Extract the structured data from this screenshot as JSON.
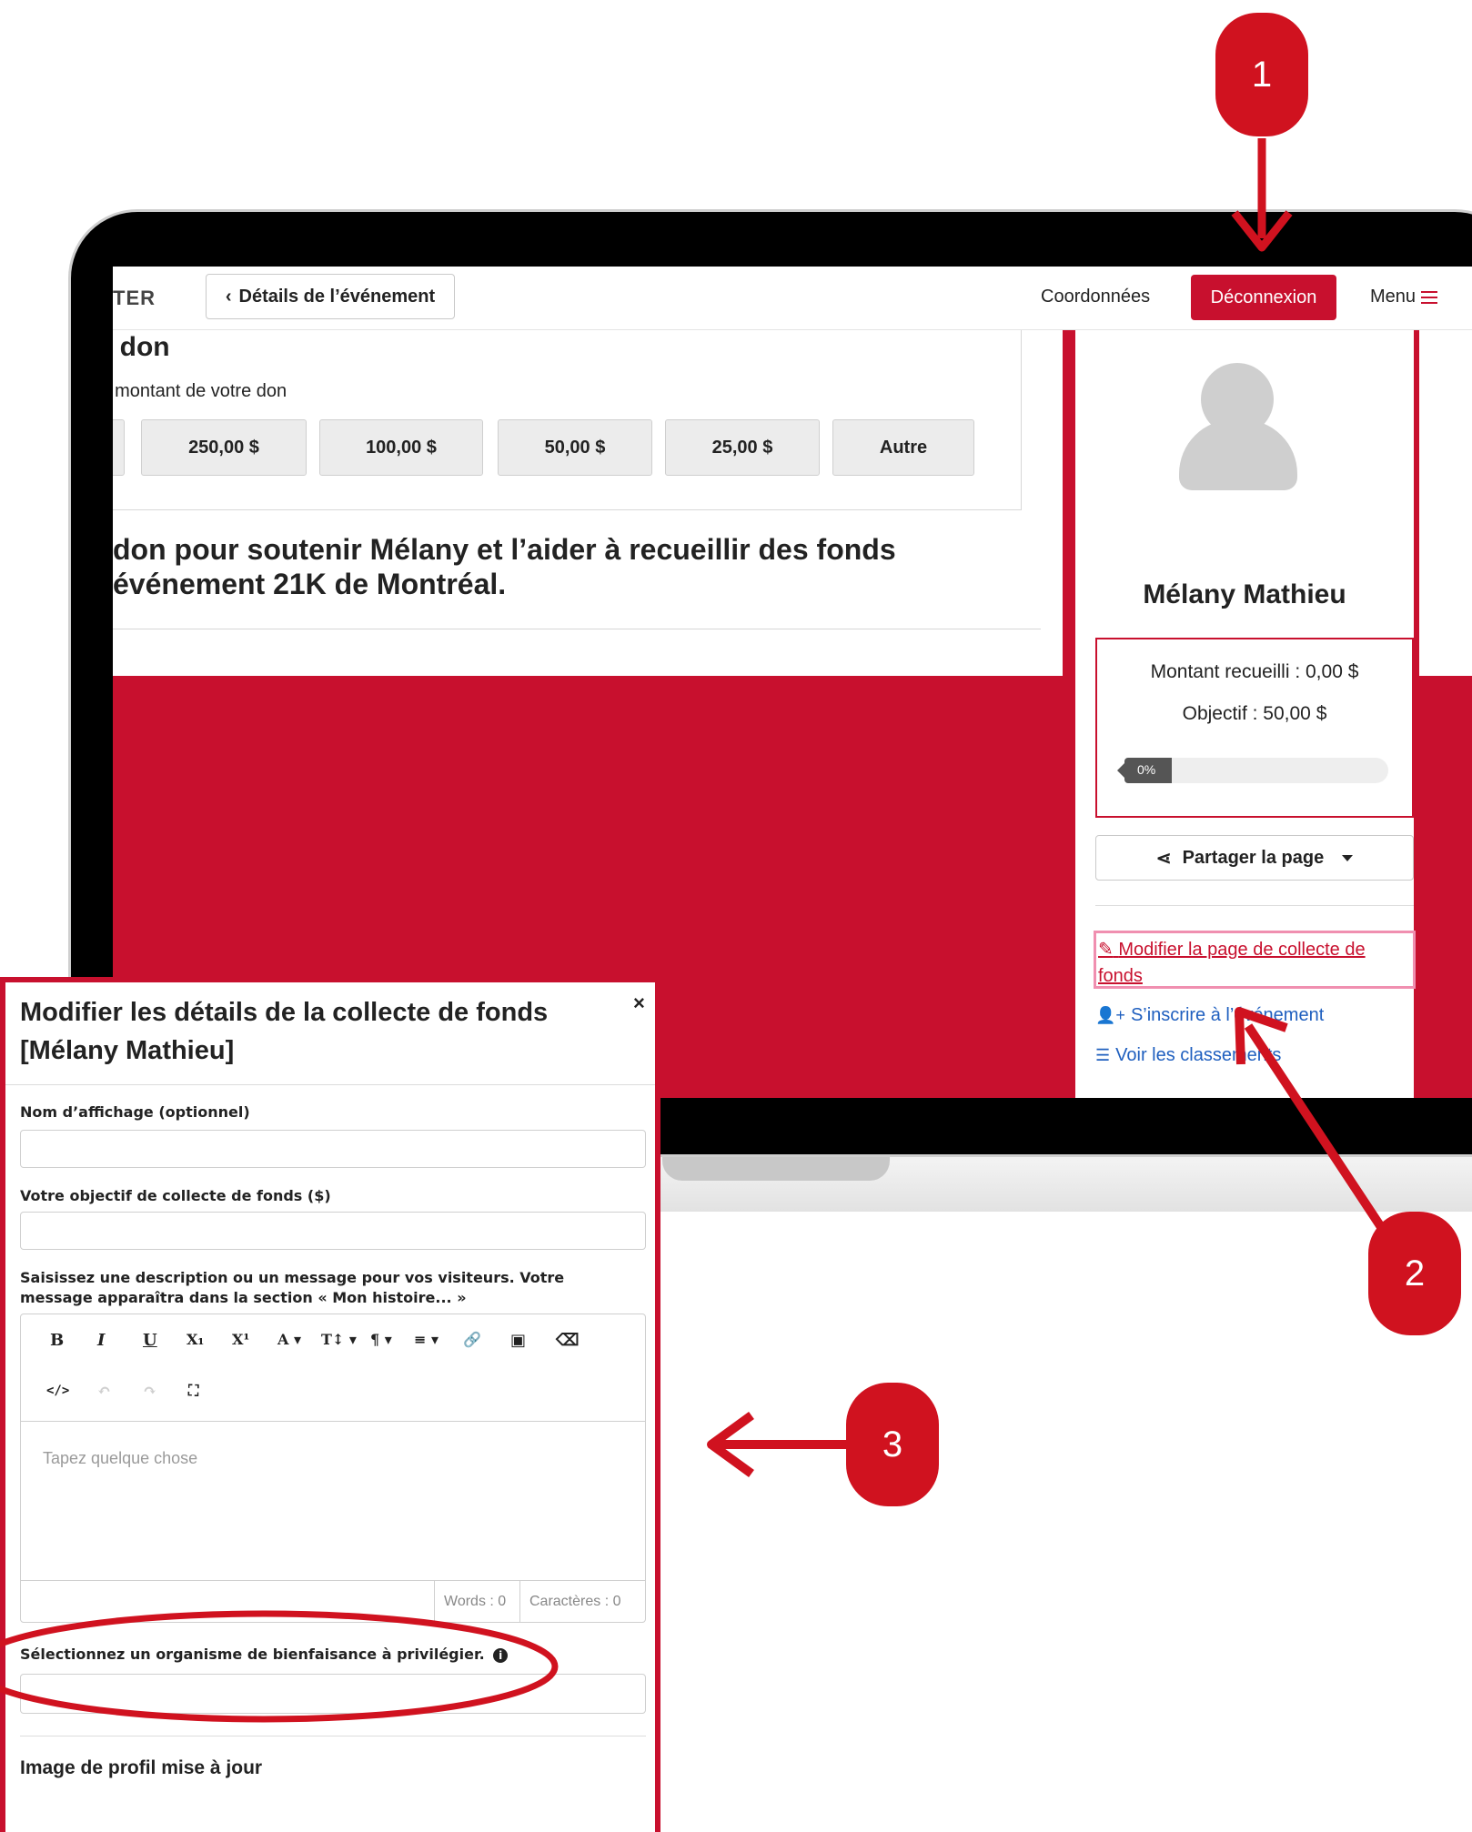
{
  "header": {
    "brand_fragment": "TER",
    "back_button": "Détails de l’événement",
    "back_chevron": "‹",
    "contact_link": "Coordonnées",
    "logout_button": "Déconnexion",
    "menu_link": "Menu"
  },
  "donation": {
    "title_fragment": "n don",
    "amount_label": "le montant de votre don",
    "amounts": [
      "$",
      "250,00 $",
      "100,00 $",
      "50,00 $",
      "25,00 $",
      "Autre"
    ],
    "support_line1": "don pour soutenir Mélany et l’aider à recueillir des fonds",
    "support_line2": "événement 21K de Montréal."
  },
  "sidebar": {
    "name": "Mélany Mathieu",
    "raised": "Montant recueilli : 0,00 $",
    "goal": "Objectif : 50,00 $",
    "progress_label": "0%",
    "progress_percent": 0,
    "share_button": "Partager la page",
    "edit_link": "Modifier la page de collecte de fonds",
    "register_link": "S’inscrire à l’événement",
    "rankings_link": "Voir les classements"
  },
  "modal": {
    "title": "Modifier les détails de la collecte de fonds [Mélany Mathieu]",
    "close": "×",
    "display_name_label": "Nom d’affichage (optionnel)",
    "goal_label": "Votre objectif de collecte de fonds ($)",
    "description_label": "Saisissez une description ou un message pour vos visiteurs. Votre message apparaîtra dans la section « Mon histoire... »",
    "editor_placeholder": "Tapez quelque chose",
    "words_counter": "Words : 0",
    "chars_counter": "Caractères : 0",
    "charity_label": "Sélectionnez un organisme de bienfaisance à privilégier.",
    "profile_image_heading": "Image de profil mise à jour"
  },
  "toolbar": {
    "bold": "B",
    "italic": "I",
    "underline": "U",
    "subscript": "X₁",
    "superscript": "X¹",
    "font_color": "A ▾",
    "font_size": "T↕ ▾",
    "paragraph": "¶ ▾",
    "align": "≡ ▾",
    "link": "🔗",
    "image": "▣",
    "eraser": "⌫",
    "code": "</>",
    "undo": "↶",
    "redo": "↷",
    "fullscreen": "⛶"
  },
  "annotations": {
    "step1": "1",
    "step2": "2",
    "step3": "3",
    "accent_color": "#d0121f"
  },
  "colors": {
    "brand_red": "#c8102e",
    "link_blue": "#1f5fbf",
    "highlight_pink": "#f08fb0"
  }
}
